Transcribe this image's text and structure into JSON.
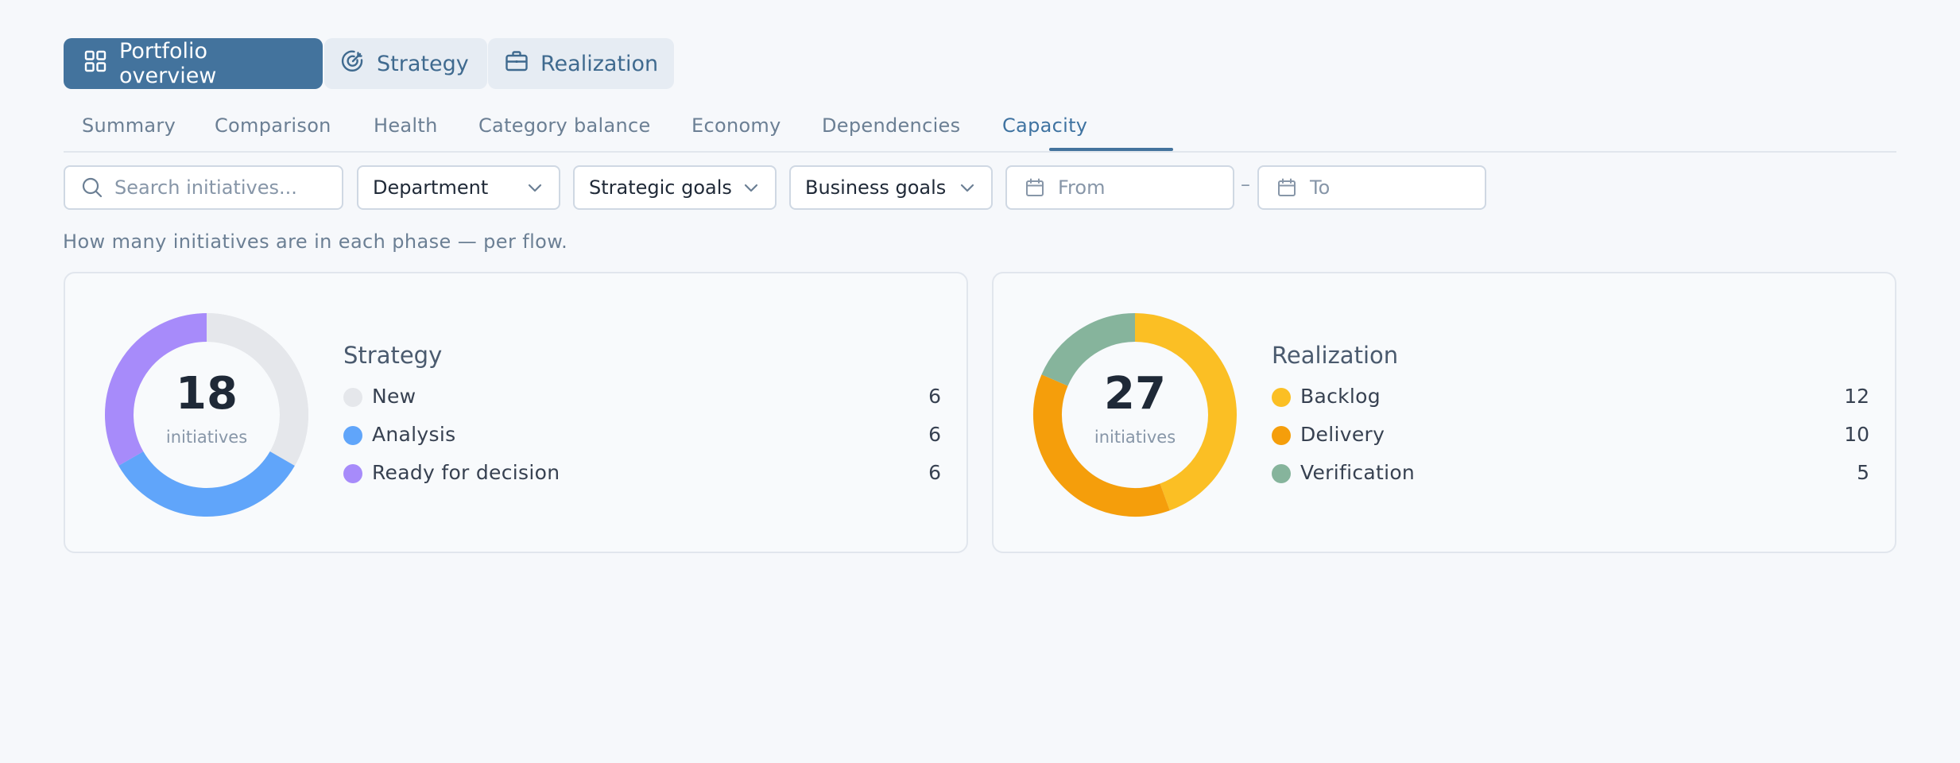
{
  "view_switch": {
    "portfolio": "Portfolio overview",
    "strategy": "Strategy",
    "realization": "Realization"
  },
  "tabs": [
    "Summary",
    "Comparison",
    "Health",
    "Category balance",
    "Economy",
    "Dependencies",
    "Capacity"
  ],
  "active_tab": "Capacity",
  "filters": {
    "search_placeholder": "Search initiatives...",
    "department": "Department",
    "strategic_goals": "Strategic goals",
    "business_goals": "Business goals",
    "from_placeholder": "From",
    "separator": "–",
    "to_placeholder": "To"
  },
  "caption": "How many initiatives are in each phase — per flow.",
  "flows": [
    {
      "title": "Strategy",
      "total": "18",
      "unit": "initiatives",
      "phases": [
        {
          "label": "New",
          "value": "6",
          "color": "#e5e7eb"
        },
        {
          "label": "Analysis",
          "value": "6",
          "color": "#60a5fa"
        },
        {
          "label": "Ready for decision",
          "value": "6",
          "color": "#a78bfa"
        }
      ]
    },
    {
      "title": "Realization",
      "total": "27",
      "unit": "initiatives",
      "phases": [
        {
          "label": "Backlog",
          "value": "12",
          "color": "#fbbf24"
        },
        {
          "label": "Delivery",
          "value": "10",
          "color": "#f59e0b"
        },
        {
          "label": "Verification",
          "value": "5",
          "color": "#86b49c"
        }
      ]
    }
  ]
}
